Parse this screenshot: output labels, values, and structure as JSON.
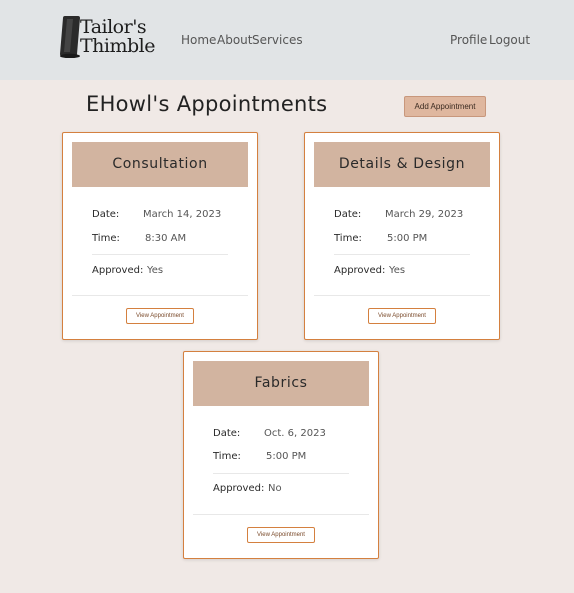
{
  "brand": {
    "line1": "Tailor's",
    "line2": "Thimble"
  },
  "nav": {
    "left": [
      "Home",
      "About",
      "Services"
    ],
    "right": [
      "Profile",
      "Logout"
    ]
  },
  "page": {
    "title": "EHowl's Appointments",
    "add_button": "Add Appointment"
  },
  "labels": {
    "date": "Date:",
    "time": "Time:",
    "approved": "Approved:",
    "view": "View Appointment"
  },
  "appointments": [
    {
      "title": "Consultation",
      "date": "March 14, 2023",
      "time": "8:30 AM",
      "approved": "Yes"
    },
    {
      "title": "Details & Design",
      "date": "March 29, 2023",
      "time": "5:00 PM",
      "approved": "Yes"
    },
    {
      "title": "Fabrics",
      "date": "Oct. 6, 2023",
      "time": "5:00 PM",
      "approved": "No"
    }
  ],
  "colors": {
    "navbar": "#e1e4e6",
    "page_bg": "#f0e9e6",
    "card_border": "#d4803f",
    "card_header": "#d2b4a0",
    "add_button": "#dfb79f"
  }
}
